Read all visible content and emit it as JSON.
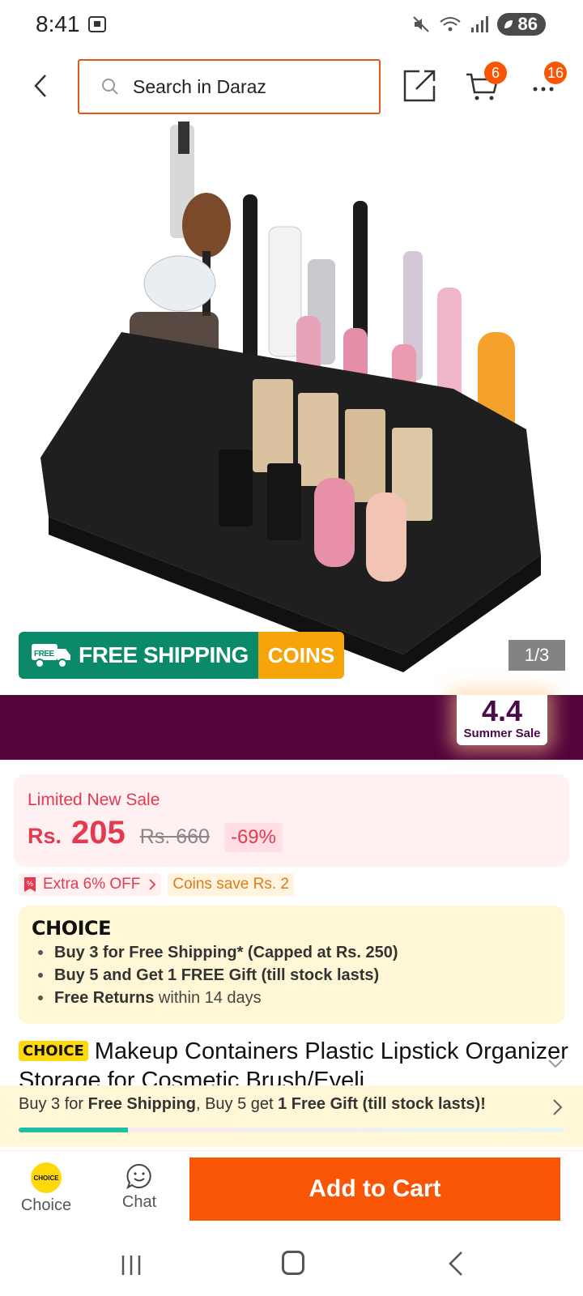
{
  "status_bar": {
    "time": "8:41",
    "battery": "86"
  },
  "header": {
    "search_placeholder": "Search in Daraz",
    "cart_badge": "6",
    "more_badge": "16"
  },
  "gallery": {
    "shipping_label": "FREE SHIPPING",
    "shipping_tag": "FREE",
    "coins_label": "COINS",
    "page_indicator": "1/3"
  },
  "campaign": {
    "big": "4.4",
    "small": "Summer Sale"
  },
  "price": {
    "label": "Limited New Sale",
    "currency": "Rs.",
    "current": "205",
    "original": "Rs. 660",
    "discount": "-69%"
  },
  "promos": {
    "extra_off": "Extra 6% OFF",
    "coins_save": "Coins save Rs. 2"
  },
  "choice": {
    "logo": "CHOICE",
    "benefits": [
      {
        "text": "Buy 3 for  Free Shipping* (Capped at Rs. 250)"
      },
      {
        "text": "Buy 5 and Get 1 FREE Gift (till stock lasts)"
      },
      {
        "bold": "Free Returns",
        "text": " within 14 days"
      }
    ]
  },
  "product": {
    "badge": "CHOICE",
    "title": "Makeup Containers Plastic Lipstick Organizer Storage for Cosmetic Brush/Eyeli"
  },
  "bundle": {
    "p1": "Buy 3 for ",
    "b1": "Free Shipping",
    "p2": ", Buy 5 get ",
    "b2": "1 Free Gift (till stock lasts)!",
    "progress": 0.2
  },
  "bottom_bar": {
    "choice_label": "Choice",
    "choice_logo": "CHOICE",
    "chat_label": "Chat",
    "add_to_cart": "Add to Cart"
  }
}
